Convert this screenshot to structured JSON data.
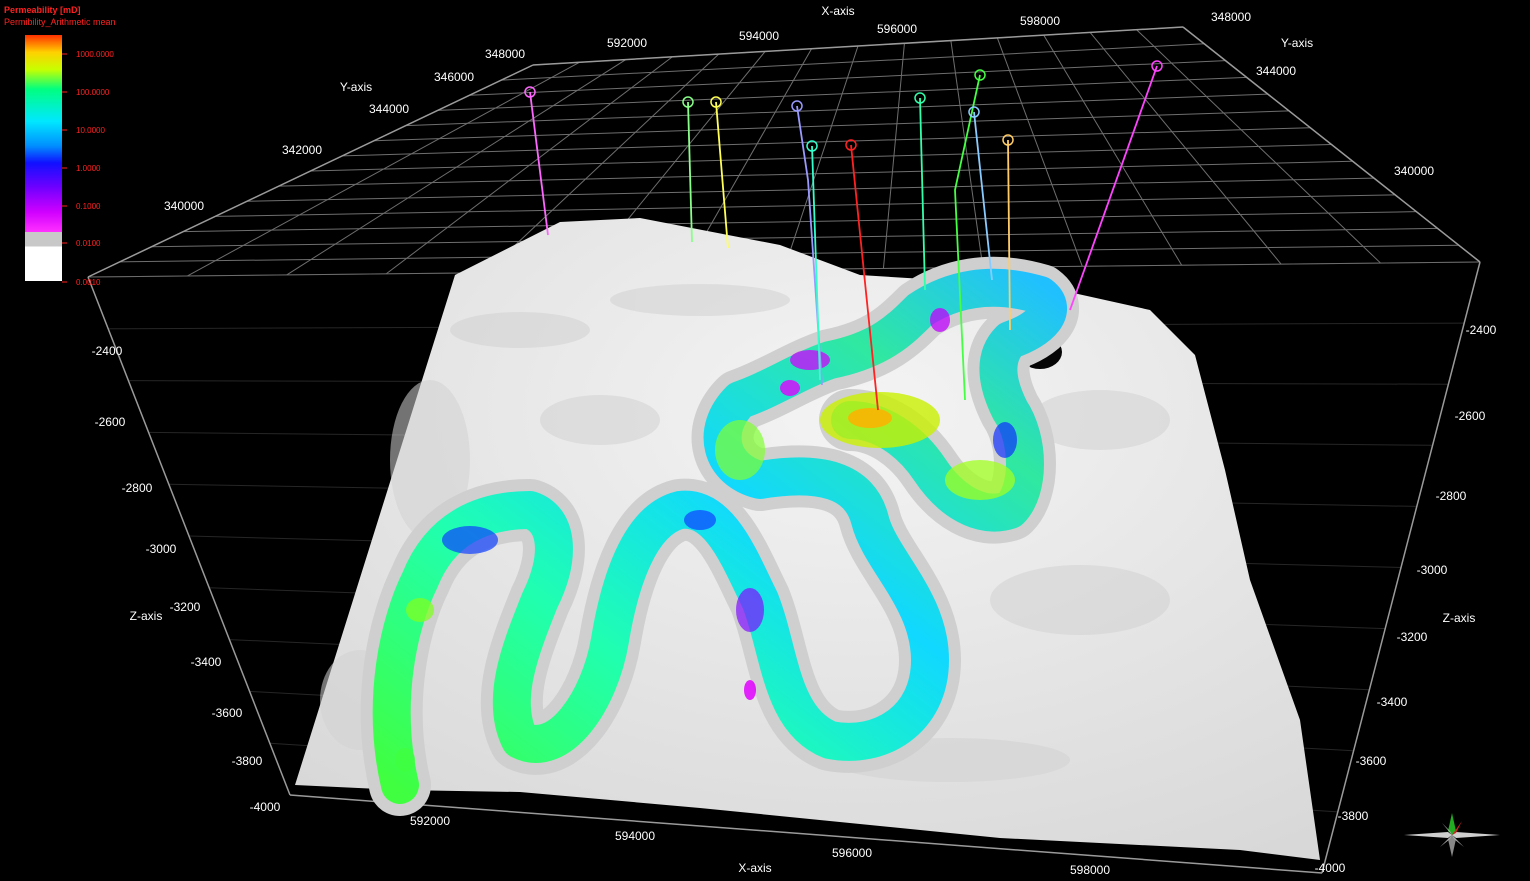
{
  "legend": {
    "title": "Permeability [mD]",
    "subtitle": "Permibility_Arithmetic mean",
    "ticks": [
      "1000.0000",
      "100.0000",
      "10.0000",
      "1.0000",
      "0.1000",
      "0.0100",
      "0.0010"
    ]
  },
  "axes": {
    "x_title_top": "X-axis",
    "x_title_bottom": "X-axis",
    "y_title_left": "Y-axis",
    "y_title_right": "Y-axis",
    "z_title_left": "Z-axis",
    "z_title_right": "Z-axis",
    "x_ticks_top": [
      "592000",
      "594000",
      "596000",
      "598000"
    ],
    "x_ticks_bottom": [
      "592000",
      "594000",
      "596000",
      "598000"
    ],
    "y_ticks_left": [
      "348000",
      "346000",
      "344000",
      "342000",
      "340000"
    ],
    "y_ticks_right": [
      "348000",
      "344000",
      "340000"
    ],
    "z_ticks_left": [
      "-2400",
      "-2600",
      "-2800",
      "-3000",
      "-3200",
      "-3400",
      "-3600",
      "-3800",
      "-4000"
    ],
    "z_ticks_right": [
      "-2400",
      "-2600",
      "-2800",
      "-3000",
      "-3200",
      "-3400",
      "-3600",
      "-3800",
      "-4000"
    ]
  },
  "colors": {
    "background": "#000000",
    "grid": "#6e6e6e",
    "surface": "#e9e9e9",
    "legend_text": "#ff2020"
  },
  "wells": [
    {
      "color": "#ff66ff"
    },
    {
      "color": "#88ff88"
    },
    {
      "color": "#ffff55"
    },
    {
      "color": "#9999ff"
    },
    {
      "color": "#33ffcc"
    },
    {
      "color": "#ff2222"
    },
    {
      "color": "#33ffaa"
    },
    {
      "color": "#44ff44"
    },
    {
      "color": "#88ccff"
    },
    {
      "color": "#ffcc66"
    },
    {
      "color": "#ff44ff"
    }
  ],
  "compass": {
    "icon": "compass-rose-icon"
  }
}
